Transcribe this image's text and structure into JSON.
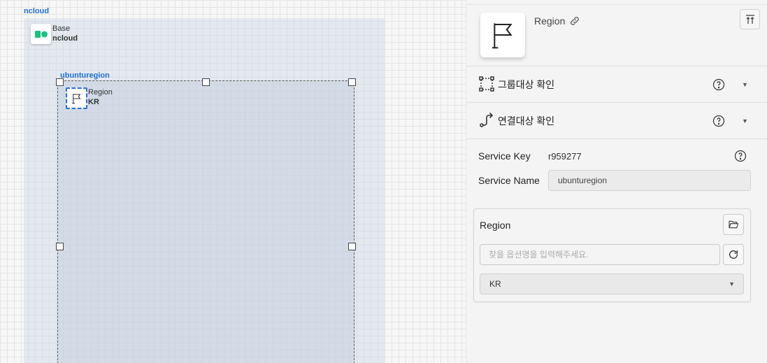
{
  "canvas": {
    "ncloud_group_label": "ncloud",
    "base_node": {
      "type_label": "Base",
      "name": "ncloud"
    },
    "region_group_label": "ubunturegion",
    "region_node": {
      "type_label": "Region",
      "name": "KR"
    }
  },
  "panel": {
    "title": "Region",
    "accordions": [
      {
        "label": "그룹대상 확인"
      },
      {
        "label": "연결대상 확인"
      }
    ],
    "service_key_label": "Service Key",
    "service_key_value": "r959277",
    "service_name_label": "Service Name",
    "service_name_value": "ubunturegion",
    "region_card": {
      "title": "Region",
      "search_placeholder": "찾을 옵션명을 입력해주세요.",
      "selected_value": "KR"
    }
  },
  "colors": {
    "group_label": "#1f6fd1",
    "selection_dash": "#2d6fd6",
    "ncloud_green": "#19c37d"
  },
  "icons": [
    "ncloud-logo-icon",
    "flag-icon",
    "link-icon",
    "collapse-top-icon",
    "group-select-icon",
    "connection-icon",
    "help-icon",
    "chevron-down-icon",
    "folder-open-icon",
    "refresh-icon"
  ]
}
